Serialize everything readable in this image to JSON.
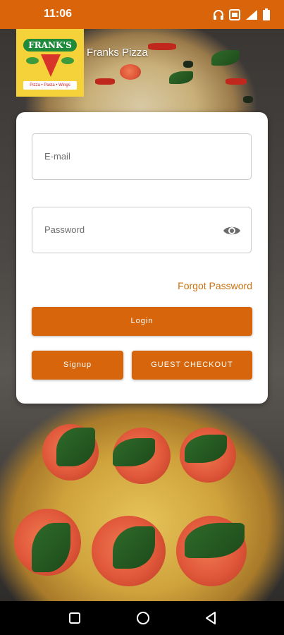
{
  "status_bar": {
    "time": "11:06",
    "icons": [
      "headphones-icon",
      "screen-record-icon",
      "signal-icon",
      "battery-icon"
    ]
  },
  "header": {
    "logo": {
      "banner_text": "FRANK'S",
      "tagline": "Pizza • Pasta • Wings"
    },
    "title": "Franks Pizza"
  },
  "login_form": {
    "email_placeholder": "E-mail",
    "password_placeholder": "Password",
    "forgot_password": "Forgot Password",
    "login_label": "Login",
    "signup_label": "Signup",
    "guest_checkout_label": "GUEST CHECKOUT"
  },
  "colors": {
    "accent": "#d9640a",
    "link": "#c9710f",
    "card_bg": "#ffffff"
  },
  "nav_bar": {
    "icons": [
      "recent-apps-icon",
      "home-icon",
      "back-icon"
    ]
  }
}
